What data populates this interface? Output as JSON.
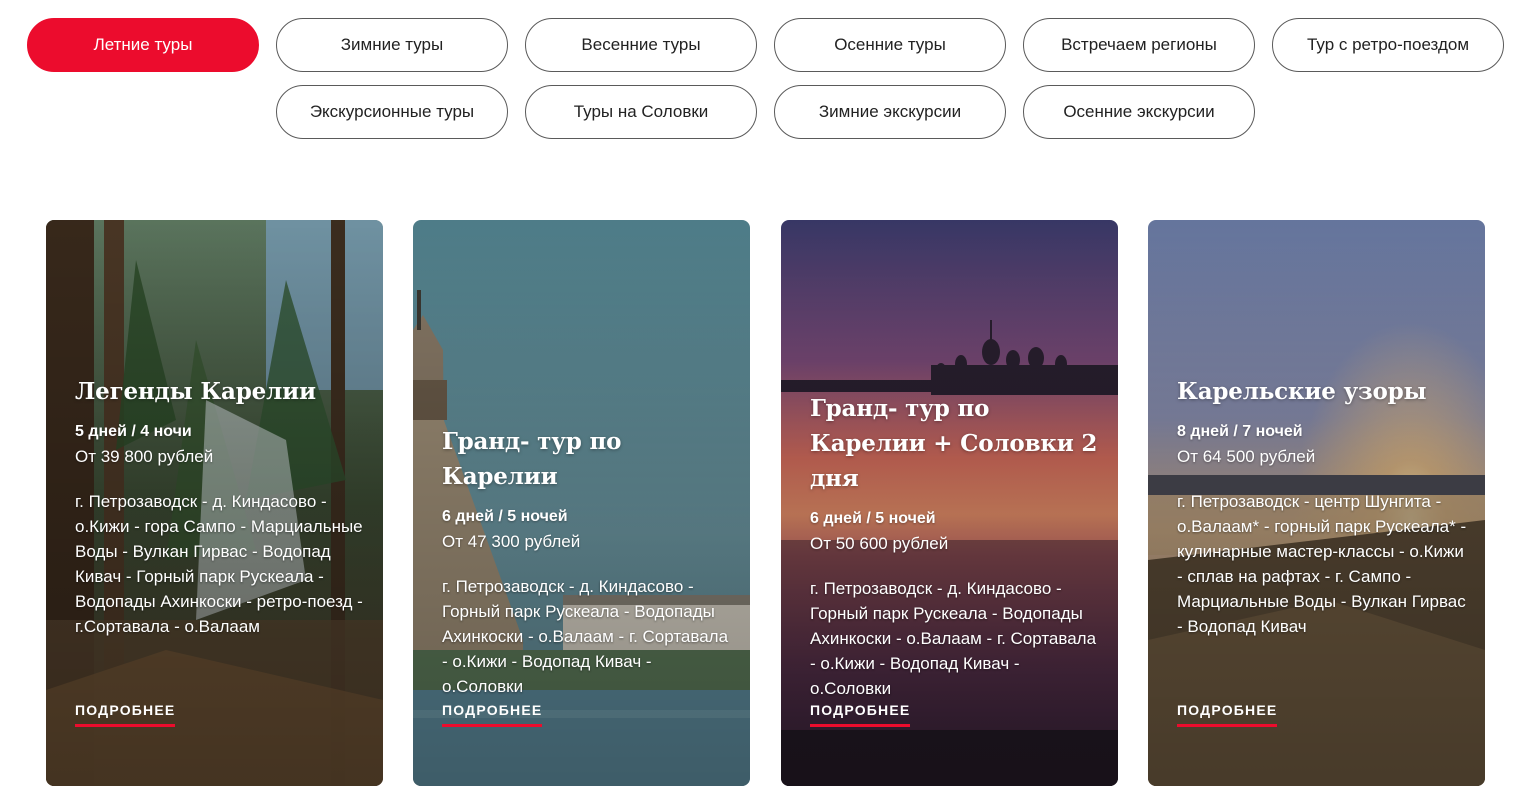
{
  "tabs": [
    {
      "label": "Летние туры",
      "active": true
    },
    {
      "label": "Зимние туры"
    },
    {
      "label": "Весенние туры"
    },
    {
      "label": "Осенние туры"
    },
    {
      "label": "Встречаем регионы"
    },
    {
      "label": "Тур с ретро-поездом"
    },
    {
      "label": "Экскурсионные туры"
    },
    {
      "label": "Туры на Соловки"
    },
    {
      "label": "Зимние экскурсии"
    },
    {
      "label": "Осенние экскурсии"
    }
  ],
  "cards": [
    {
      "title": "Легенды Карелии",
      "duration": "5 дней / 4 ночи",
      "price": "От 39 800 рублей",
      "route": "г. Петрозаводск - д. Киндасово - о.Кижи - гора Сампо - Марциальные Воды - Вулкан Гирвас - Водопад Кивач - Горный парк Рускеала - Водопады Ахинкоски - ретро-поезд - г.Сортавала - о.Валаам",
      "more": "ПОДРОБНЕЕ"
    },
    {
      "title": "Гранд- тур по Карелии",
      "duration": "6 дней / 5 ночей",
      "price": "От 47 300 рублей",
      "route": "г. Петрозаводск - д. Киндасово - Горный парк Рускеала - Водопады Ахинкоски - о.Валаам - г. Сортавала - о.Кижи - Водопад Кивач - о.Соловки",
      "more": "ПОДРОБНЕЕ"
    },
    {
      "title": "Гранд- тур по Карелии + Соловки 2 дня",
      "duration": "6 дней / 5 ночей",
      "price": "От 50 600 рублей",
      "route": "г. Петрозаводск - д. Киндасово - Горный парк Рускеала - Водопады Ахинкоски - о.Валаам - г. Сортавала - о.Кижи - Водопад Кивач - о.Соловки",
      "more": "ПОДРОБНЕЕ"
    },
    {
      "title": "Карельские узоры",
      "duration": "8 дней / 7 ночей",
      "price": "От 64 500 рублей",
      "route": "г. Петрозаводск - центр Шунгита - о.Валаам* - горный парк Рускеала* - кулинарные мастер-классы - о.Кижи - сплав на рафтах - г. Сампо - Марциальные Воды - Вулкан Гирвас - Водопад Кивач",
      "more": "ПОДРОБНЕЕ"
    }
  ],
  "colors": {
    "accent": "#ec0c2d",
    "tab_border": "#5a5a5a",
    "text_dark": "#222222"
  }
}
